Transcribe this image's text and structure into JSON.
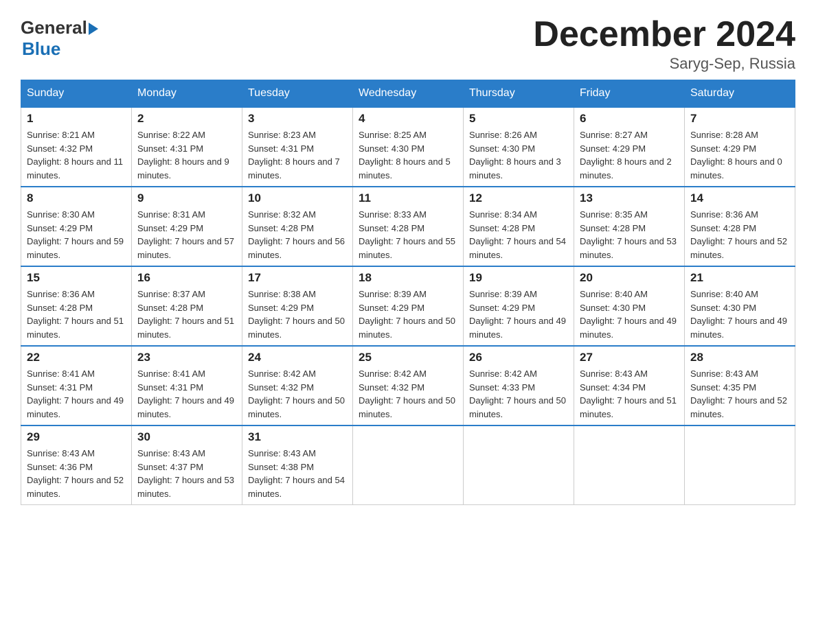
{
  "header": {
    "logo": {
      "general": "General",
      "blue": "Blue"
    },
    "title": "December 2024",
    "location": "Saryg-Sep, Russia"
  },
  "days_of_week": [
    "Sunday",
    "Monday",
    "Tuesday",
    "Wednesday",
    "Thursday",
    "Friday",
    "Saturday"
  ],
  "weeks": [
    [
      {
        "day": "1",
        "sunrise": "8:21 AM",
        "sunset": "4:32 PM",
        "daylight": "8 hours and 11 minutes."
      },
      {
        "day": "2",
        "sunrise": "8:22 AM",
        "sunset": "4:31 PM",
        "daylight": "8 hours and 9 minutes."
      },
      {
        "day": "3",
        "sunrise": "8:23 AM",
        "sunset": "4:31 PM",
        "daylight": "8 hours and 7 minutes."
      },
      {
        "day": "4",
        "sunrise": "8:25 AM",
        "sunset": "4:30 PM",
        "daylight": "8 hours and 5 minutes."
      },
      {
        "day": "5",
        "sunrise": "8:26 AM",
        "sunset": "4:30 PM",
        "daylight": "8 hours and 3 minutes."
      },
      {
        "day": "6",
        "sunrise": "8:27 AM",
        "sunset": "4:29 PM",
        "daylight": "8 hours and 2 minutes."
      },
      {
        "day": "7",
        "sunrise": "8:28 AM",
        "sunset": "4:29 PM",
        "daylight": "8 hours and 0 minutes."
      }
    ],
    [
      {
        "day": "8",
        "sunrise": "8:30 AM",
        "sunset": "4:29 PM",
        "daylight": "7 hours and 59 minutes."
      },
      {
        "day": "9",
        "sunrise": "8:31 AM",
        "sunset": "4:29 PM",
        "daylight": "7 hours and 57 minutes."
      },
      {
        "day": "10",
        "sunrise": "8:32 AM",
        "sunset": "4:28 PM",
        "daylight": "7 hours and 56 minutes."
      },
      {
        "day": "11",
        "sunrise": "8:33 AM",
        "sunset": "4:28 PM",
        "daylight": "7 hours and 55 minutes."
      },
      {
        "day": "12",
        "sunrise": "8:34 AM",
        "sunset": "4:28 PM",
        "daylight": "7 hours and 54 minutes."
      },
      {
        "day": "13",
        "sunrise": "8:35 AM",
        "sunset": "4:28 PM",
        "daylight": "7 hours and 53 minutes."
      },
      {
        "day": "14",
        "sunrise": "8:36 AM",
        "sunset": "4:28 PM",
        "daylight": "7 hours and 52 minutes."
      }
    ],
    [
      {
        "day": "15",
        "sunrise": "8:36 AM",
        "sunset": "4:28 PM",
        "daylight": "7 hours and 51 minutes."
      },
      {
        "day": "16",
        "sunrise": "8:37 AM",
        "sunset": "4:28 PM",
        "daylight": "7 hours and 51 minutes."
      },
      {
        "day": "17",
        "sunrise": "8:38 AM",
        "sunset": "4:29 PM",
        "daylight": "7 hours and 50 minutes."
      },
      {
        "day": "18",
        "sunrise": "8:39 AM",
        "sunset": "4:29 PM",
        "daylight": "7 hours and 50 minutes."
      },
      {
        "day": "19",
        "sunrise": "8:39 AM",
        "sunset": "4:29 PM",
        "daylight": "7 hours and 49 minutes."
      },
      {
        "day": "20",
        "sunrise": "8:40 AM",
        "sunset": "4:30 PM",
        "daylight": "7 hours and 49 minutes."
      },
      {
        "day": "21",
        "sunrise": "8:40 AM",
        "sunset": "4:30 PM",
        "daylight": "7 hours and 49 minutes."
      }
    ],
    [
      {
        "day": "22",
        "sunrise": "8:41 AM",
        "sunset": "4:31 PM",
        "daylight": "7 hours and 49 minutes."
      },
      {
        "day": "23",
        "sunrise": "8:41 AM",
        "sunset": "4:31 PM",
        "daylight": "7 hours and 49 minutes."
      },
      {
        "day": "24",
        "sunrise": "8:42 AM",
        "sunset": "4:32 PM",
        "daylight": "7 hours and 50 minutes."
      },
      {
        "day": "25",
        "sunrise": "8:42 AM",
        "sunset": "4:32 PM",
        "daylight": "7 hours and 50 minutes."
      },
      {
        "day": "26",
        "sunrise": "8:42 AM",
        "sunset": "4:33 PM",
        "daylight": "7 hours and 50 minutes."
      },
      {
        "day": "27",
        "sunrise": "8:43 AM",
        "sunset": "4:34 PM",
        "daylight": "7 hours and 51 minutes."
      },
      {
        "day": "28",
        "sunrise": "8:43 AM",
        "sunset": "4:35 PM",
        "daylight": "7 hours and 52 minutes."
      }
    ],
    [
      {
        "day": "29",
        "sunrise": "8:43 AM",
        "sunset": "4:36 PM",
        "daylight": "7 hours and 52 minutes."
      },
      {
        "day": "30",
        "sunrise": "8:43 AM",
        "sunset": "4:37 PM",
        "daylight": "7 hours and 53 minutes."
      },
      {
        "day": "31",
        "sunrise": "8:43 AM",
        "sunset": "4:38 PM",
        "daylight": "7 hours and 54 minutes."
      },
      null,
      null,
      null,
      null
    ]
  ],
  "labels": {
    "sunrise": "Sunrise:",
    "sunset": "Sunset:",
    "daylight": "Daylight:"
  }
}
